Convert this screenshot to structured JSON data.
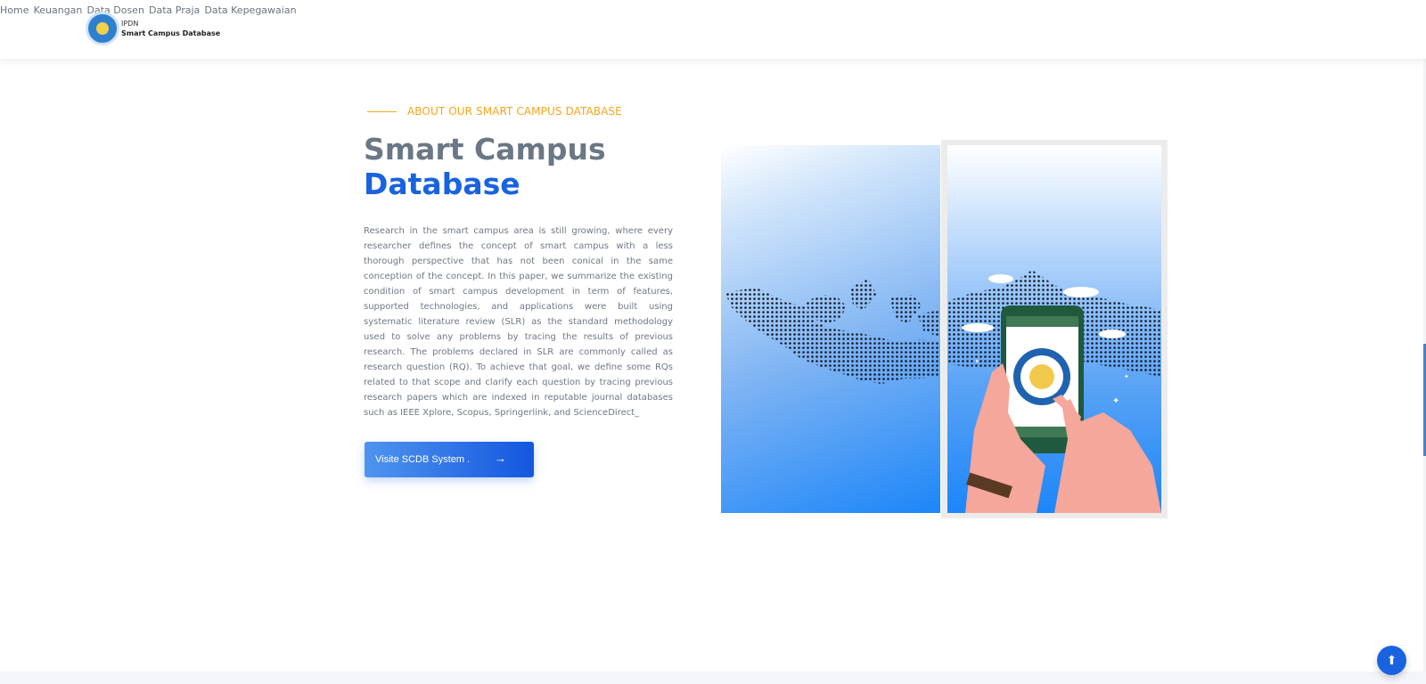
{
  "header": {
    "logo_small": "IPDN",
    "logo_big": "Smart Campus Database",
    "nav": [
      {
        "label": "Home"
      },
      {
        "label": "Keuangan"
      },
      {
        "label": "Data Dosen"
      },
      {
        "label": "Data Praja"
      },
      {
        "label": "Data Kepegawaian"
      }
    ]
  },
  "about": {
    "eyebrow": "ABOUT OUR SMART CAMPUS DATABASE",
    "title_line1": "Smart Campus",
    "title_line2": "Database",
    "description": "Research in the smart campus area is still growing, where every researcher defines the concept of smart campus with a less thorough perspective that has not been conical in the same conception of the concept. In this paper, we summarize the existing condition of smart campus development in term of features, supported technologies, and applications were built using systematic literature review (SLR) as the standard methodology used to solve any problems by tracing the results of previous research. The problems declared in SLR are commonly called as research question (RQ). To achieve that goal, we define some RQs related to that scope and clarify each question by tracing previous research papers which are indexed in reputable journal databases such as IEEE Xplore, Scopus, Springerlink, and ScienceDirect_",
    "cta_label": "Visite SCDB System .",
    "cta_icon": "arrow-right-icon"
  },
  "scroll_to_top_icon": "arrow-up-icon",
  "colors": {
    "accent": "#1a63e0",
    "eyebrow": "#f4a51c",
    "title_gray": "#6b7785"
  }
}
